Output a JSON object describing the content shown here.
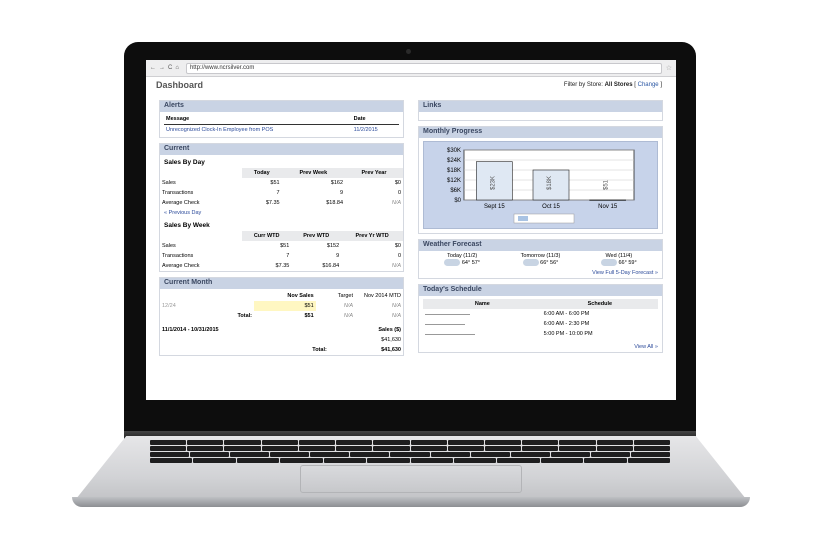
{
  "browser": {
    "url": "http://www.ncrsilver.com"
  },
  "page": {
    "title": "Dashboard",
    "filter_label": "Filter by Store:",
    "filter_value": "All Stores",
    "change_label": "Change"
  },
  "alerts": {
    "title": "Alerts",
    "col_message": "Message",
    "col_date": "Date",
    "rows": [
      {
        "message": "Unrecognized Clock-In Employee from POS",
        "date": "11/2/2015"
      }
    ]
  },
  "current": {
    "title": "Current",
    "by_day": {
      "title": "Sales By Day",
      "headers": [
        "Today",
        "Prev Week",
        "Prev Year"
      ],
      "rows": [
        {
          "label": "Sales",
          "values": [
            "$51",
            "$162",
            "$0"
          ]
        },
        {
          "label": "Transactions",
          "values": [
            "7",
            "9",
            "0"
          ]
        },
        {
          "label": "Average Check",
          "values": [
            "$7.35",
            "$18.84",
            "N/A"
          ]
        }
      ],
      "prev_link": "« Previous Day"
    },
    "by_week": {
      "title": "Sales By Week",
      "headers": [
        "Curr WTD",
        "Prev WTD",
        "Prev Yr WTD"
      ],
      "rows": [
        {
          "label": "Sales",
          "values": [
            "$51",
            "$152",
            "$0"
          ]
        },
        {
          "label": "Transactions",
          "values": [
            "7",
            "9",
            "0"
          ]
        },
        {
          "label": "Average Check",
          "values": [
            "$7.35",
            "$16.84",
            "N/A"
          ]
        }
      ]
    }
  },
  "current_month": {
    "title": "Current Month",
    "headers": [
      "Nov Sales",
      "Target",
      "Nov 2014 MTD"
    ],
    "row_label": "12/24",
    "row_values": [
      "$51",
      "N/A",
      "N/A"
    ],
    "total_label": "Total:",
    "total_values": [
      "$51",
      "N/A",
      "N/A"
    ],
    "range_label": "11/1/2014 - 10/31/2015",
    "range_col": "Sales ($)",
    "range_value": "$41,630",
    "range_total_label": "Total:",
    "range_total_value": "$41,630"
  },
  "links": {
    "title": "Links"
  },
  "chart_data": {
    "type": "bar",
    "title": "Monthly Progress",
    "categories": [
      "Sept 15",
      "Oct 15",
      "Nov 15"
    ],
    "values": [
      23000,
      18000,
      51
    ],
    "data_labels": [
      "$23K",
      "$18K",
      "$51"
    ],
    "y_ticks": [
      "$30K",
      "$24K",
      "$18K",
      "$12K",
      "$6K",
      "$0"
    ],
    "ylim": [
      0,
      30000
    ],
    "grid": true,
    "colors": {
      "bar": "#dfe8f3",
      "bar_border": "#222222",
      "bg": "#c7d3ea"
    }
  },
  "weather": {
    "title": "Weather Forecast",
    "days": [
      {
        "label": "Today (11/2)",
        "high": "64°",
        "low": "57°",
        "icon": "rain-cloud-icon"
      },
      {
        "label": "Tomorrow (11/3)",
        "high": "66°",
        "low": "56°",
        "icon": "cloud-icon"
      },
      {
        "label": "Wed (11/4)",
        "high": "66°",
        "low": "59°",
        "icon": "cloud-icon"
      }
    ],
    "forecast_link": "View Full 5-Day Forecast »"
  },
  "schedule": {
    "title": "Today's Schedule",
    "col_name": "Name",
    "col_schedule": "Schedule",
    "rows": [
      "6:00 AM - 6:00 PM",
      "6:00 AM - 2:30 PM",
      "5:00 PM - 10:00 PM"
    ],
    "view_all": "View All »"
  }
}
